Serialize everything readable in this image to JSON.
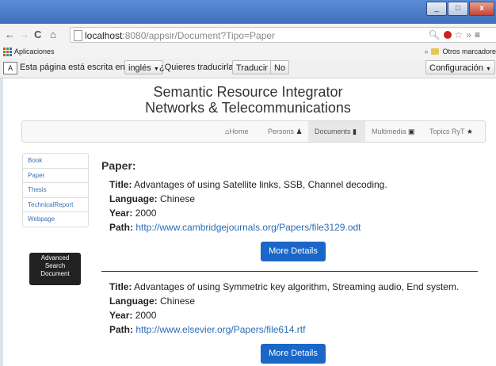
{
  "browser": {
    "window_close": "x",
    "url_host": "localhost",
    "url_path": ":8080/appsir/Document?Tipo=Paper",
    "bookmarks_apps": "Aplicaciones",
    "bookmarks_other": "Otros marcadore",
    "bookmarks_more": "»",
    "ext_more": "»"
  },
  "translate_bar": {
    "text": "Esta página está escrita en",
    "language": "inglés",
    "question": "¿Quieres traducirla?",
    "translate_btn": "Traducir",
    "no_btn": "No",
    "config_btn": "Configuración"
  },
  "header": {
    "title_line1": "Semantic Resource Integrator",
    "title_line2": "Networks & Telecommunications"
  },
  "navbar": {
    "items": [
      {
        "label": "Home",
        "icon": "home-icon",
        "glyph": "★"
      },
      {
        "label": "Persons",
        "icon": "user-icon",
        "glyph": "♟"
      },
      {
        "label": "Documents",
        "icon": "file-icon",
        "glyph": "▮"
      },
      {
        "label": "Multimedia",
        "icon": "film-icon",
        "glyph": "▣"
      },
      {
        "label": "Topics RyT",
        "icon": "star-icon",
        "glyph": "★"
      }
    ],
    "active": "Documents"
  },
  "sidebar": {
    "items": [
      {
        "label": "Book"
      },
      {
        "label": "Paper"
      },
      {
        "label": "Thesis"
      },
      {
        "label": "TechnicalReport"
      },
      {
        "label": "Webpage"
      }
    ],
    "advanced_line1": "Advanced",
    "advanced_line2": "Search",
    "advanced_line3": "Document"
  },
  "main": {
    "heading": "Paper:",
    "labels": {
      "title": "Title:",
      "language": "Language:",
      "year": "Year:",
      "path": "Path:"
    },
    "more_details": "More Details",
    "records": [
      {
        "title": "Advantages of using Satellite links, SSB, Channel decoding.",
        "language": "Chinese",
        "year": "2000",
        "path": "http://www.cambridgejournals.org/Papers/file3129.odt"
      },
      {
        "title": "Advantages of using Symmetric key algorithm, Streaming audio, End system.",
        "language": "Chinese",
        "year": "2000",
        "path": "http://www.elsevier.org/Papers/file614.rtf"
      }
    ]
  }
}
